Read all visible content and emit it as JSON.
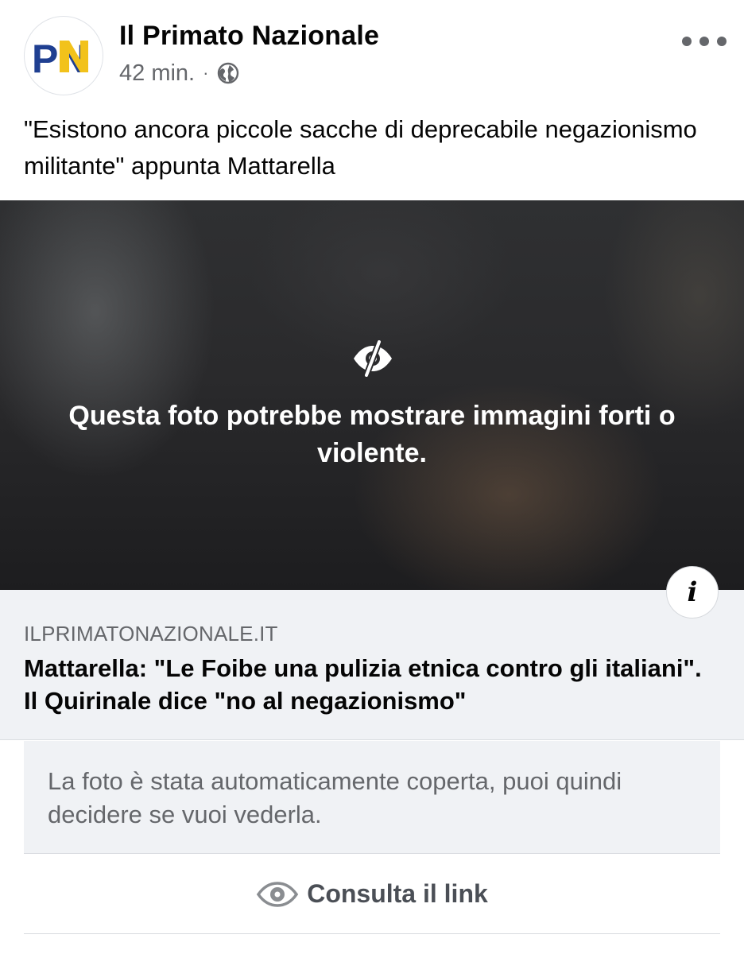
{
  "post": {
    "author": {
      "name": "Il Primato Nazionale",
      "avatar_text": "PN",
      "avatar_colors": {
        "p": "#1f3f91",
        "n": "#f2c21b",
        "n_shadow": "#c69b12"
      }
    },
    "timestamp": "42 min.",
    "separator": "·",
    "audience_icon": "globe-icon",
    "menu_icon": "more-horizontal-icon",
    "text": "\"Esistono ancora piccole sacche di deprecabile negazionismo militante\" appunta Mattarella"
  },
  "media": {
    "icon": "eye-slash-icon",
    "warning": "Questa foto potrebbe mostrare immagini forti o violente."
  },
  "link_preview": {
    "domain": "ILPRIMATONAZIONALE.IT",
    "title": "Mattarella: \"Le Foibe una pulizia etnica contro gli italiani\". Il Quirinale dice \"no al negazionismo\"",
    "info_label": "i"
  },
  "notice": {
    "text": "La foto è stata automaticamente coperta, puoi quindi decidere se vuoi vederla."
  },
  "action": {
    "icon": "eye-icon",
    "label": "Consulta il link"
  },
  "colors": {
    "text_primary": "#050505",
    "text_secondary": "#65676b",
    "panel_bg": "#f0f2f5",
    "action_text": "#4b4f56"
  }
}
